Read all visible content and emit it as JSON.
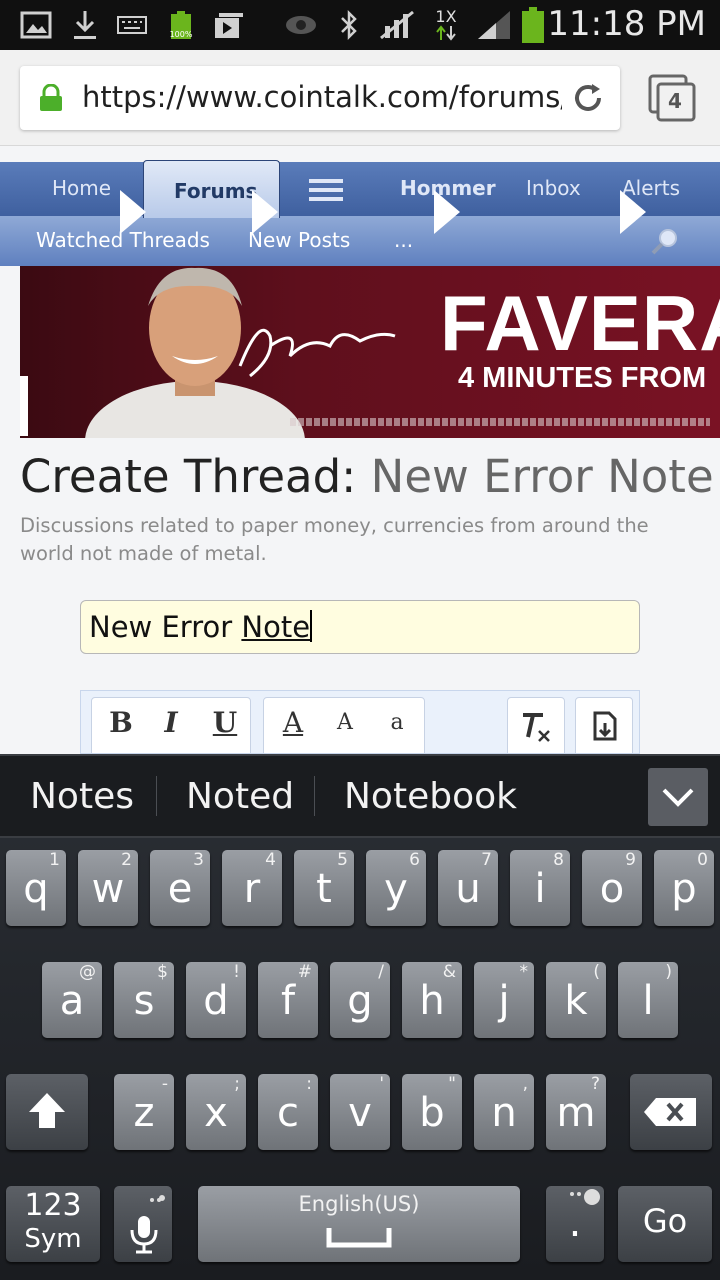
{
  "status_bar": {
    "battery_small_label": "100%",
    "network_label": "1X",
    "time": "11:18 PM"
  },
  "browser": {
    "url": "https://www.cointalk.com/forums/p",
    "tab_count": "4"
  },
  "forum_nav": {
    "row1": [
      "Home",
      "Forums",
      "Hommer",
      "Inbox",
      "Alerts"
    ],
    "row2": [
      "Watched Threads",
      "New Posts",
      "..."
    ]
  },
  "ad": {
    "headline": "FAVERA",
    "subline": "4 MINUTES FROM"
  },
  "page": {
    "title_prefix": "Create Thread:",
    "title_forum": "New Error Note",
    "description": "Discussions related to paper money, currencies from around the world not made of metal.",
    "title_input_value_part1": "New Error ",
    "title_input_value_part2": "Note"
  },
  "editor_toolbar": {
    "bold": "B",
    "italic": "I",
    "underline": "U",
    "font_color": "A",
    "font_size": "A",
    "font_case": "a"
  },
  "keyboard": {
    "suggestions": [
      "Notes",
      "Noted",
      "Notebook"
    ],
    "row1": [
      {
        "k": "q",
        "s": "1"
      },
      {
        "k": "w",
        "s": "2"
      },
      {
        "k": "e",
        "s": "3"
      },
      {
        "k": "r",
        "s": "4"
      },
      {
        "k": "t",
        "s": "5"
      },
      {
        "k": "y",
        "s": "6"
      },
      {
        "k": "u",
        "s": "7"
      },
      {
        "k": "i",
        "s": "8"
      },
      {
        "k": "o",
        "s": "9"
      },
      {
        "k": "p",
        "s": "0"
      }
    ],
    "row2": [
      {
        "k": "a",
        "s": "@"
      },
      {
        "k": "s",
        "s": "$"
      },
      {
        "k": "d",
        "s": "!"
      },
      {
        "k": "f",
        "s": "#"
      },
      {
        "k": "g",
        "s": "/"
      },
      {
        "k": "h",
        "s": "&"
      },
      {
        "k": "j",
        "s": "*"
      },
      {
        "k": "k",
        "s": "("
      },
      {
        "k": "l",
        "s": ")"
      }
    ],
    "row3": [
      {
        "k": "z",
        "s": "-"
      },
      {
        "k": "x",
        "s": ";"
      },
      {
        "k": "c",
        "s": ":"
      },
      {
        "k": "v",
        "s": "'"
      },
      {
        "k": "b",
        "s": "\""
      },
      {
        "k": "n",
        "s": ","
      },
      {
        "k": "m",
        "s": "?"
      }
    ],
    "sym_label_1": "123",
    "sym_label_2": "Sym",
    "space_label": "English(US)",
    "period": ".",
    "go": "Go"
  }
}
